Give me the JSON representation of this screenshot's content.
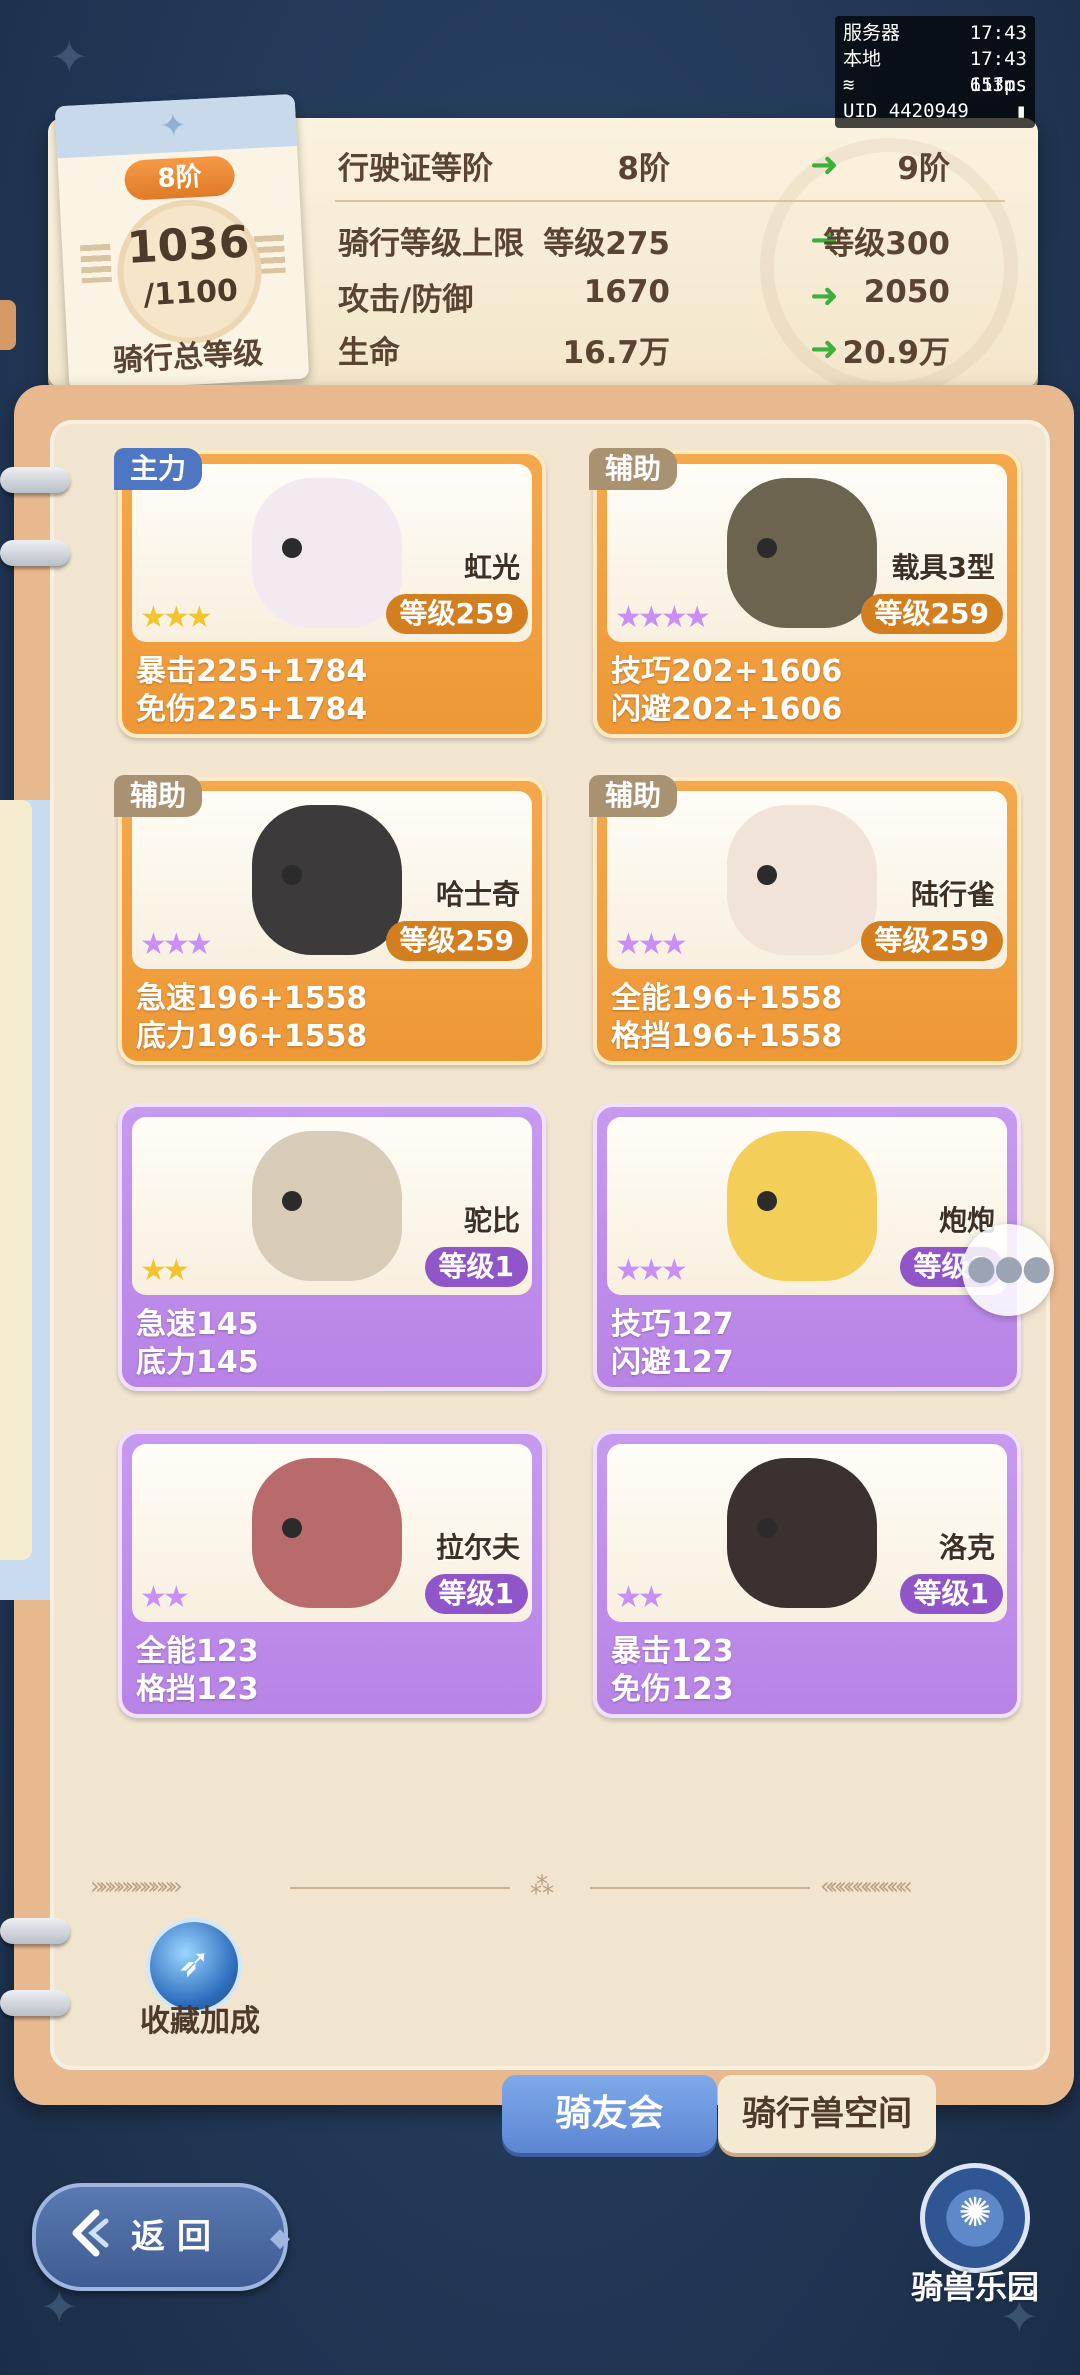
{
  "debug": {
    "server_label": "服务器",
    "server_time": "17:43",
    "local_label": "本地",
    "local_time": "17:43",
    "ping": "153ms",
    "fps": "61fps",
    "uid": "UID 4420949"
  },
  "level_card": {
    "tier": "8阶",
    "current": "1036",
    "max": "/1100",
    "label": "骑行总等级"
  },
  "stats": [
    {
      "label": "行驶证等阶",
      "from": "8阶",
      "to": "9阶"
    },
    {
      "label": "骑行等级上限",
      "from": "等级275",
      "to": "等级300"
    },
    {
      "label": "攻击/防御",
      "from": "1670",
      "to": "2050"
    },
    {
      "label": "生命",
      "from": "16.7万",
      "to": "20.9万"
    }
  ],
  "mounts": [
    {
      "tag": "主力",
      "name": "虹光",
      "level": "等级259",
      "stars": 3,
      "purple_stars": 0,
      "stat1": "暴击225+1784",
      "stat2": "免伤225+1784",
      "rarity": "gold"
    },
    {
      "tag": "辅助",
      "name": "载具3型",
      "level": "等级259",
      "stars": 0,
      "purple_stars": 4,
      "stat1": "技巧202+1606",
      "stat2": "闪避202+1606",
      "rarity": "gold"
    },
    {
      "tag": "辅助",
      "name": "哈士奇",
      "level": "等级259",
      "stars": 0,
      "purple_stars": 3,
      "stat1": "急速196+1558",
      "stat2": "底力196+1558",
      "rarity": "gold"
    },
    {
      "tag": "辅助",
      "name": "陆行雀",
      "level": "等级259",
      "stars": 0,
      "purple_stars": 3,
      "stat1": "全能196+1558",
      "stat2": "格挡196+1558",
      "rarity": "gold"
    },
    {
      "tag": "",
      "name": "驼比",
      "level": "等级1",
      "stars": 2,
      "purple_stars": 0,
      "stat1": "急速145",
      "stat2": "底力145",
      "rarity": "purple"
    },
    {
      "tag": "",
      "name": "炮炮",
      "level": "等级1",
      "stars": 0,
      "purple_stars": 3,
      "stat1": "技巧127",
      "stat2": "闪避127",
      "rarity": "purple"
    },
    {
      "tag": "",
      "name": "拉尔夫",
      "level": "等级1",
      "stars": 0,
      "purple_stars": 2,
      "stat1": "全能123",
      "stat2": "格挡123",
      "rarity": "purple"
    },
    {
      "tag": "",
      "name": "洛克",
      "level": "等级1",
      "stars": 0,
      "purple_stars": 2,
      "stat1": "暴击123",
      "stat2": "免伤123",
      "rarity": "purple"
    }
  ],
  "bonus": {
    "label": "收藏加成"
  },
  "tabs": {
    "club": "骑友会",
    "space": "骑行兽空间"
  },
  "back": {
    "label": "返回"
  },
  "park": {
    "label": "骑兽乐园"
  },
  "colors": {
    "gold_card": "#f0a040",
    "purple_card": "#bd8ae8",
    "tab_active": "#6b94dc",
    "arrow": "#3cb03a"
  }
}
